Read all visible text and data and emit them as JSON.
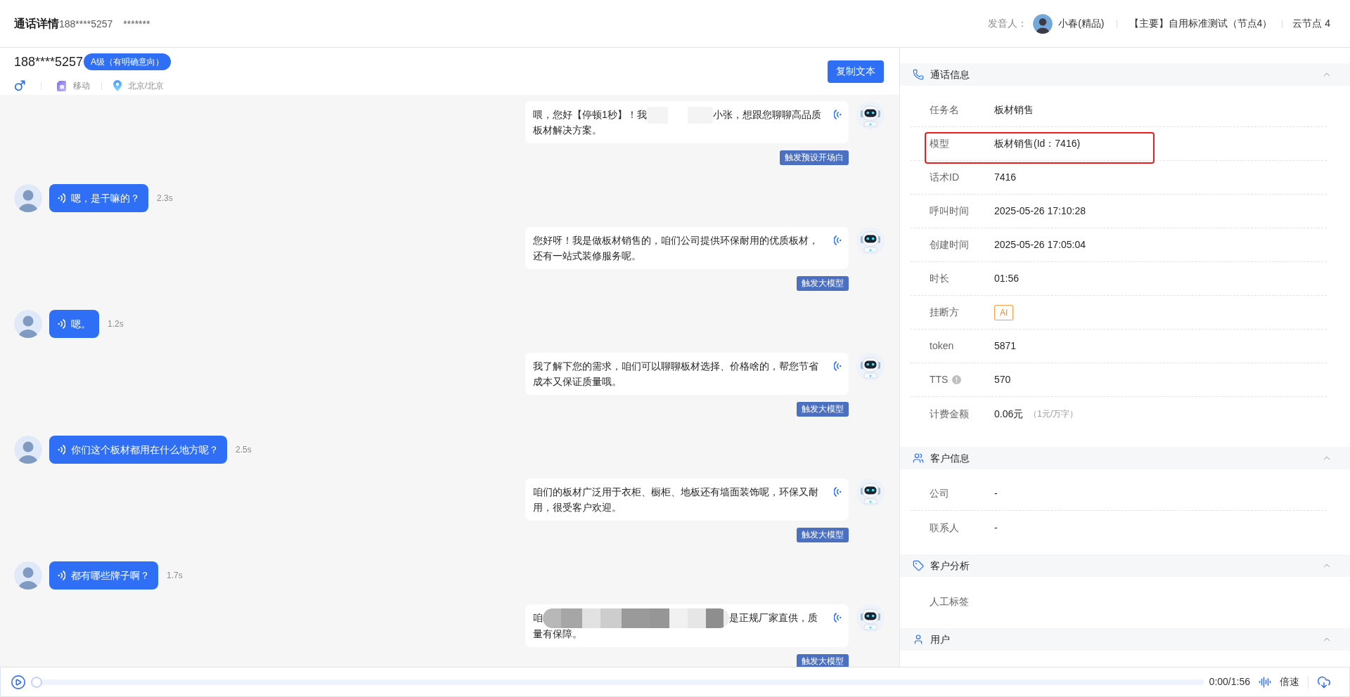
{
  "header": {
    "title": "通话详情",
    "phone": "188****5257",
    "masked_name": "*******",
    "speaker_label": "发音人：",
    "speaker": "小春(精品)",
    "line": "【主要】自用标准测试（节点4）",
    "node": "云节点 4"
  },
  "customer": {
    "phone": "188****5257",
    "grade": "A级（有明确意向）",
    "carrier": "移动",
    "location": "北京/北京",
    "copy_button": "复制文本"
  },
  "messages": [
    {
      "kind": "bot",
      "parts": [
        {
          "kind": "text",
          "text": "喂，您好【停顿1秒】！我"
        },
        {
          "kind": "blur"
        },
        {
          "kind": "text",
          "text": "小张，想跟您聊聊高品质板材解决方案。"
        }
      ],
      "tag": "触发预设开场白"
    },
    {
      "kind": "user",
      "parts": [
        {
          "kind": "text",
          "text": "嗯，是干嘛的？"
        }
      ],
      "duration": "2.3s"
    },
    {
      "kind": "bot",
      "parts": [
        {
          "kind": "text",
          "text": "您好呀！我是做板材销售的，咱们公司提供环保耐用的优质板材，还有一站式装修服务呢。"
        }
      ],
      "tag": "触发大模型"
    },
    {
      "kind": "user",
      "parts": [
        {
          "kind": "text",
          "text": "嗯。"
        }
      ],
      "duration": "1.2s"
    },
    {
      "kind": "bot",
      "parts": [
        {
          "kind": "text",
          "text": "我了解下您的需求，咱们可以聊聊板材选择、价格啥的，帮您节省成本又保证质量哦。"
        }
      ],
      "tag": "触发大模型"
    },
    {
      "kind": "user",
      "parts": [
        {
          "kind": "text",
          "text": "你们这个板材都用在什么地方呢？"
        }
      ],
      "duration": "2.5s"
    },
    {
      "kind": "bot",
      "parts": [
        {
          "kind": "text",
          "text": "咱们的板材广泛用于衣柜、橱柜、地板还有墙面装饰呢，环保又耐用，很受客户欢迎。"
        }
      ],
      "tag": "触发大模型"
    },
    {
      "kind": "user",
      "parts": [
        {
          "kind": "text",
          "text": "都有哪些牌子啊？"
        }
      ],
      "duration": "1.7s"
    },
    {
      "kind": "bot",
      "parts": [
        {
          "kind": "text",
          "text": "咱"
        },
        {
          "kind": "mosaic"
        },
        {
          "kind": "text",
          "text": "是正规厂家直供，质量有保障。"
        }
      ],
      "tag": "触发大模型"
    }
  ],
  "sections": [
    {
      "title": "通话信息",
      "expanded": true,
      "rows": [
        {
          "kind": "text",
          "label": "任务名",
          "value": "板材销售",
          "highlighted": false,
          "hint": false
        },
        {
          "kind": "text",
          "label": "模型",
          "value": "板材销售(Id：7416)",
          "highlighted": true,
          "hint": false
        },
        {
          "kind": "text",
          "label": "话术ID",
          "value": "7416",
          "highlighted": false,
          "hint": false
        },
        {
          "kind": "text",
          "label": "呼叫时间",
          "value": "2025-05-26 17:10:28",
          "highlighted": false,
          "hint": false
        },
        {
          "kind": "text",
          "label": "创建时间",
          "value": "2025-05-26 17:05:04",
          "highlighted": false,
          "hint": false
        },
        {
          "kind": "text",
          "label": "时长",
          "value": "01:56",
          "highlighted": false,
          "hint": false
        },
        {
          "kind": "tag",
          "label": "挂断方",
          "value": "AI",
          "highlighted": false,
          "hint": false
        },
        {
          "kind": "text",
          "label": "token",
          "value": "5871",
          "highlighted": false,
          "hint": false
        },
        {
          "kind": "text",
          "label": "TTS",
          "value": "570",
          "highlighted": false,
          "hint": true
        },
        {
          "kind": "text",
          "label": "计费金额",
          "value": "0.06元",
          "note": "（1元/万字）",
          "highlighted": false,
          "hint": false
        }
      ]
    },
    {
      "title": "客户信息",
      "expanded": true,
      "rows": [
        {
          "kind": "text",
          "label": "公司",
          "value": "-",
          "highlighted": false,
          "hint": false
        },
        {
          "kind": "text",
          "label": "联系人",
          "value": "-",
          "highlighted": false,
          "hint": false
        }
      ]
    },
    {
      "title": "客户分析",
      "expanded": true,
      "rows": [
        {
          "kind": "text",
          "label": "人工标签",
          "highlighted": false,
          "hint": false
        }
      ]
    },
    {
      "title": "用户",
      "expanded": true
    }
  ],
  "player": {
    "time": "0:00/1:56",
    "speed": "倍速",
    "level": 0
  }
}
